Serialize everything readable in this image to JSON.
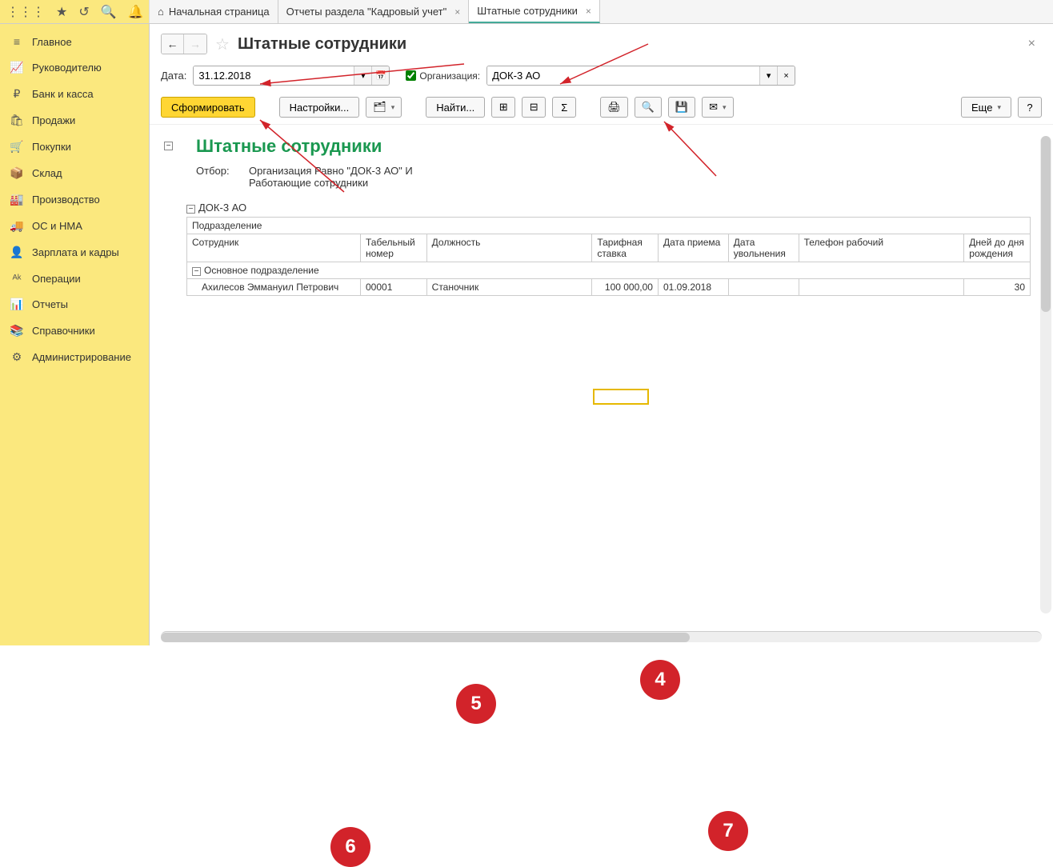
{
  "tabs": {
    "home": "Начальная страница",
    "reports": "Отчеты раздела \"Кадровый учет\"",
    "staff": "Штатные сотрудники"
  },
  "sidebar": {
    "items": [
      {
        "icon": "≡",
        "label": "Главное"
      },
      {
        "icon": "📈",
        "label": "Руководителю"
      },
      {
        "icon": "₽",
        "label": "Банк и касса"
      },
      {
        "icon": "🛍",
        "label": "Продажи"
      },
      {
        "icon": "🛒",
        "label": "Покупки"
      },
      {
        "icon": "📦",
        "label": "Склад"
      },
      {
        "icon": "🏭",
        "label": "Производство"
      },
      {
        "icon": "🚚",
        "label": "ОС и НМА"
      },
      {
        "icon": "👤",
        "label": "Зарплата и кадры"
      },
      {
        "icon": "ᴬᵏ",
        "label": "Операции"
      },
      {
        "icon": "📊",
        "label": "Отчеты"
      },
      {
        "icon": "📚",
        "label": "Справочники"
      },
      {
        "icon": "⚙",
        "label": "Администрирование"
      }
    ]
  },
  "page": {
    "title": "Штатные сотрудники"
  },
  "filters": {
    "date_label": "Дата:",
    "date_value": "31.12.2018",
    "org_label": "Организация:",
    "org_value": "ДОК-3 АО"
  },
  "toolbar": {
    "generate": "Сформировать",
    "settings": "Настройки...",
    "find": "Найти...",
    "more": "Еще",
    "help": "?"
  },
  "report": {
    "title": "Штатные сотрудники",
    "filter_label": "Отбор:",
    "filter_line1": "Организация Равно \"ДОК-3 АО\" И",
    "filter_line2": "Работающие сотрудники",
    "org_group": "ДОК-3 АО",
    "headers": {
      "dept": "Подразделение",
      "employee": "Сотрудник",
      "tab_num": "Табельный номер",
      "position": "Должность",
      "rate": "Тарифная ставка",
      "hire_date": "Дата приема",
      "fire_date": "Дата увольнения",
      "phone": "Телефон рабочий",
      "days_bd": "Дней до дня рождения"
    },
    "dept_name": "Основное подразделение",
    "row1": {
      "employee": "Ахилесов Эммануил Петрович",
      "tab_num": "00001",
      "position": "Станочник",
      "rate": "100 000,00",
      "hire_date": "01.09.2018",
      "fire_date": "",
      "phone": "",
      "days_bd": "30"
    }
  },
  "annotations": {
    "n4": "4",
    "n5": "5",
    "n6": "6",
    "n7": "7"
  }
}
